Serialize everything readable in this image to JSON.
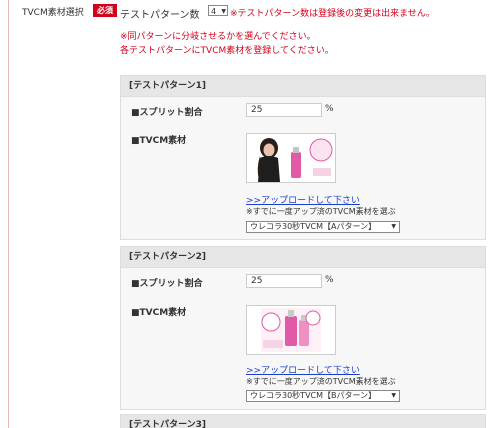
{
  "form": {
    "field_label": "TVCM素材選択",
    "required_badge": "必須",
    "pattern_count_label": "テストパターン数",
    "pattern_count_value": "4",
    "pattern_count_warning": "※テストパターン数は登録後の変更は出来ません。",
    "warning_line1": "※同パターンに分岐させるかを選んでください。",
    "warning_line2": "各テストパターンにTVCM素材を登録してください。"
  },
  "patterns": [
    {
      "header": "[テストパターン1]",
      "split_label": "■スプリット割合",
      "split_value": "25",
      "split_unit": "%",
      "material_label": "■TVCM素材",
      "upload_link": ">>アップロードして下さい",
      "select_note": "※すでに一度アップ済のTVCM素材を選ぶ",
      "selected_material": "ウレコラ30秒TVCM【Aパターン】"
    },
    {
      "header": "[テストパターン2]",
      "split_label": "■スプリット割合",
      "split_value": "25",
      "split_unit": "%",
      "material_label": "■TVCM素材",
      "upload_link": ">>アップロードして下さい",
      "select_note": "※すでに一度アップ済のTVCM素材を選ぶ",
      "selected_material": "ウレコラ30秒TVCM【Bパターン】"
    },
    {
      "header": "[テストパターン3]"
    }
  ],
  "colors": {
    "accent_red": "#d0021b",
    "link_blue": "#1b3fcf",
    "product_pink": "#e05aa8"
  },
  "icons": {
    "select_arrow": "▼"
  }
}
